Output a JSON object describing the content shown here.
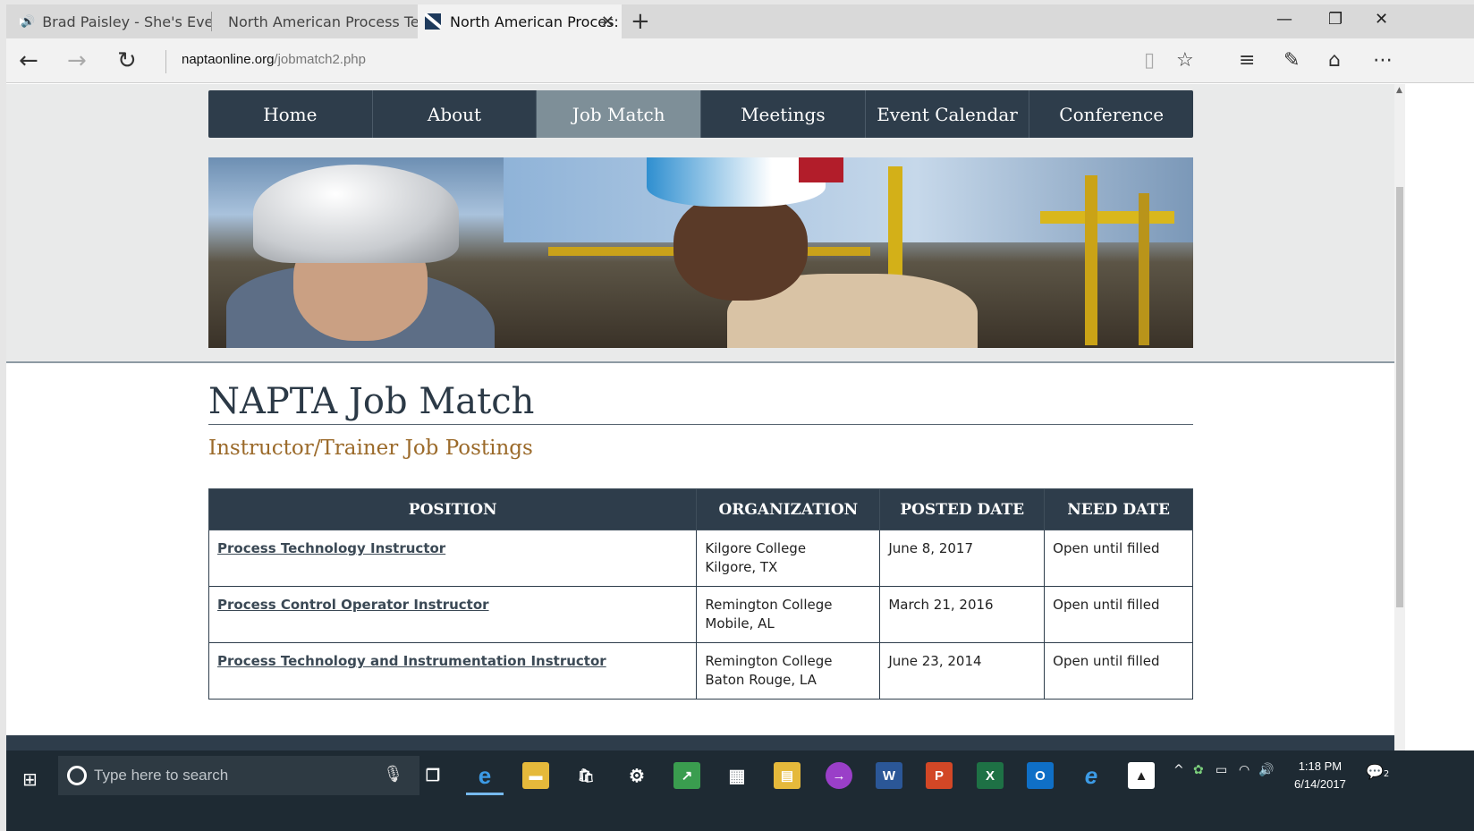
{
  "browser": {
    "tabs": [
      {
        "title": "Brad Paisley - She's Eve",
        "icon": "youtube-icon",
        "audio": true
      },
      {
        "title": "North American Process Tec",
        "icon": "napta-icon"
      },
      {
        "title": "North American Proces:",
        "icon": "napta-icon",
        "active": true
      }
    ],
    "url_domain": "naptaonline.org",
    "url_path": "/jobmatch2.php"
  },
  "site": {
    "menu": [
      {
        "label": "Home"
      },
      {
        "label": "About"
      },
      {
        "label": "Job Match",
        "active": true
      },
      {
        "label": "Meetings"
      },
      {
        "label": "Event Calendar"
      },
      {
        "label": "Conference"
      }
    ],
    "page_title": "NAPTA Job Match",
    "subtitle": "Instructor/Trainer Job Postings",
    "table": {
      "headers": [
        "POSITION",
        "ORGANIZATION",
        "POSTED DATE",
        "NEED DATE"
      ],
      "rows": [
        {
          "position": "Process Technology Instructor",
          "org_name": "Kilgore College",
          "org_location": "Kilgore, TX",
          "posted": "June 8, 2017",
          "need": "Open until filled"
        },
        {
          "position": "Process Control Operator Instructor",
          "org_name": "Remington College",
          "org_location": "Mobile, AL",
          "posted": "March 21, 2016",
          "need": "Open until filled"
        },
        {
          "position": "Process Technology and Instrumentation Instructor",
          "org_name": "Remington College",
          "org_location": "Baton Rouge, LA",
          "posted": "June 23, 2014",
          "need": "Open until filled"
        }
      ]
    }
  },
  "taskbar": {
    "search_placeholder": "Type here to search",
    "time": "1:18 PM",
    "date": "6/14/2017",
    "notification_count": "2"
  },
  "colors": {
    "nav_bg": "#2e3d4b",
    "nav_active": "#7e8f98",
    "subtitle": "#9b6a2a"
  }
}
